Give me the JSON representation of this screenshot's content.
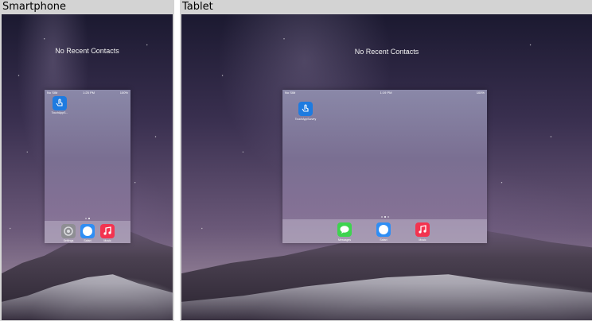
{
  "panels": {
    "smartphone": {
      "title": "Smartphone",
      "no_recent": "No Recent Contacts",
      "status_left": "No SIM",
      "status_center": "1:25 PM",
      "status_right": "100%",
      "app_label": "TouchAppS...",
      "dock": [
        {
          "label": "Settings",
          "icon": "settings-icon",
          "color": "#8e8e93"
        },
        {
          "label": "Safari",
          "icon": "safari-icon",
          "color": "#2f8ef4"
        },
        {
          "label": "Music",
          "icon": "music-icon",
          "color": "#f3334f"
        }
      ]
    },
    "tablet": {
      "title": "Tablet",
      "no_recent": "No Recent Contacts",
      "status_left": "No SIM",
      "status_center": "1:19 PM",
      "status_right": "100%",
      "app_label": "TouchAppSurvey",
      "dock": [
        {
          "label": "Messages",
          "icon": "messages-icon",
          "color": "#3ed34f"
        },
        {
          "label": "Safari",
          "icon": "safari-icon",
          "color": "#2f8ef4"
        },
        {
          "label": "Music",
          "icon": "music-icon",
          "color": "#f3334f"
        }
      ]
    }
  }
}
